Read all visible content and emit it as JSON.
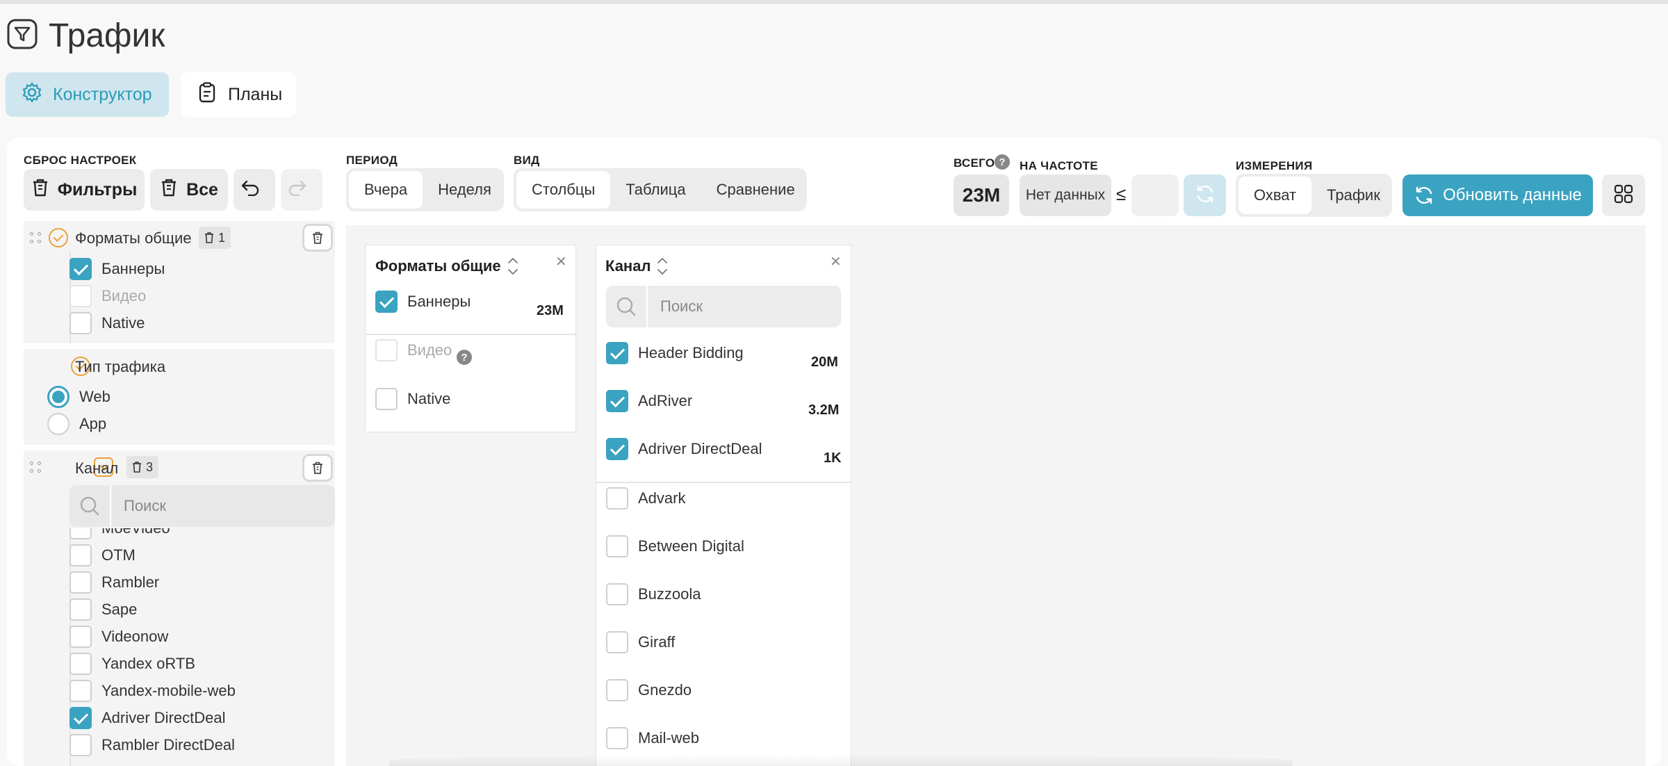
{
  "page": {
    "title": "Трафик"
  },
  "tabs": [
    {
      "label": "Конструктор",
      "active": true
    },
    {
      "label": "Планы",
      "active": false
    }
  ],
  "toolbar": {
    "reset_label": "СБРОС НАСТРОЕК",
    "filters_label": "Фильтры",
    "all_label": "Все",
    "period_label": "ПЕРИОД",
    "period_options": [
      "Вчера",
      "Неделя"
    ],
    "period_selected": "Вчера",
    "view_label": "ВИД",
    "view_options": [
      "Столбцы",
      "Таблица",
      "Сравнение"
    ],
    "view_selected": "Столбцы",
    "total_label": "ВСЕГО",
    "total_value": "23M",
    "frequency_label": "НА ЧАСТОТЕ",
    "frequency_value": "Нет данных",
    "le_sign": "≤",
    "frequency_input": "",
    "dimensions_label": "ИЗМЕРЕНИЯ",
    "dimension_options": [
      "Охват",
      "Трафик"
    ],
    "dimension_selected": "Охват",
    "refresh_label": "Обновить данные"
  },
  "sidebar": {
    "formats": {
      "title": "Форматы общие",
      "badge": "1",
      "items": [
        {
          "label": "Баннеры",
          "checked": true,
          "dim": false
        },
        {
          "label": "Видео",
          "checked": false,
          "dim": true
        },
        {
          "label": "Native",
          "checked": false,
          "dim": false
        }
      ]
    },
    "traffic_type": {
      "title": "Тип трафика",
      "options": [
        {
          "label": "Web",
          "selected": true
        },
        {
          "label": "App",
          "selected": false
        }
      ]
    },
    "channel": {
      "title": "Канал",
      "badge": "3",
      "search_placeholder": "Поиск",
      "items": [
        {
          "label": "MoeVideo",
          "checked": false
        },
        {
          "label": "OTM",
          "checked": false
        },
        {
          "label": "Rambler",
          "checked": false
        },
        {
          "label": "Sape",
          "checked": false
        },
        {
          "label": "Videonow",
          "checked": false
        },
        {
          "label": "Yandex oRTB",
          "checked": false
        },
        {
          "label": "Yandex-mobile-web",
          "checked": false
        },
        {
          "label": "Adriver DirectDeal",
          "checked": true
        },
        {
          "label": "Rambler DirectDeal",
          "checked": false
        }
      ]
    }
  },
  "cards": {
    "formats": {
      "title": "Форматы общие",
      "items": [
        {
          "label": "Баннеры",
          "checked": true,
          "value": "23M"
        },
        {
          "label": "Видео",
          "checked": false,
          "value": ""
        },
        {
          "label": "Native",
          "checked": false,
          "value": ""
        }
      ]
    },
    "channel": {
      "title": "Канал",
      "search_placeholder": "Поиск",
      "selected": [
        {
          "label": "Header Bidding",
          "checked": true,
          "value": "20M"
        },
        {
          "label": "AdRiver",
          "checked": true,
          "value": "3.2M"
        },
        {
          "label": "Adriver DirectDeal",
          "checked": true,
          "value": "1K"
        }
      ],
      "others": [
        {
          "label": "Advark",
          "checked": false
        },
        {
          "label": "Between Digital",
          "checked": false
        },
        {
          "label": "Buzzoola",
          "checked": false
        },
        {
          "label": "Giraff",
          "checked": false
        },
        {
          "label": "Gnezdo",
          "checked": false
        },
        {
          "label": "Mail-web",
          "checked": false
        }
      ]
    }
  },
  "colors": {
    "accent": "#3aa3c1",
    "accent_soft": "#cfe6ee",
    "orange": "#e9a23b",
    "refresh_button": "#3aa3c1"
  },
  "icons": [
    "filter-icon",
    "gear-icon",
    "clipboard-icon",
    "trash-icon",
    "undo-icon",
    "redo-icon",
    "help-icon",
    "refresh-icon",
    "grid-icon",
    "drag-handle-icon",
    "check-circle-icon",
    "chevron-square-icon",
    "search-icon",
    "sort-icon",
    "close-icon"
  ]
}
